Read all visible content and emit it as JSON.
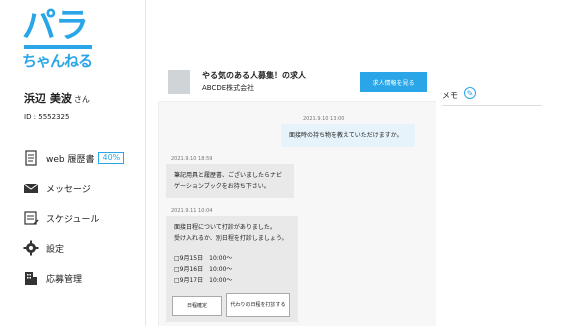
{
  "logo": {
    "line1": "パラ",
    "line2": "ちゃんねる"
  },
  "user": {
    "name": "浜辺 美波",
    "honorific": "さん",
    "id": "ID : 5552325"
  },
  "nav": [
    {
      "label": "web 履歴書",
      "badge": "40%"
    },
    {
      "label": "メッセージ"
    },
    {
      "label": "スケジュール"
    },
    {
      "label": "設定"
    },
    {
      "label": "応募管理"
    }
  ],
  "job": {
    "title": "やる気のある人募集！の求人",
    "company": "ABCDE株式会社",
    "button": "求人情報を見る"
  },
  "memo": {
    "label": "メモ"
  },
  "messages": [
    {
      "time": "2021.9.10 13:00",
      "text": "面接時の持ち物を教えていただけますか。"
    },
    {
      "time": "2021.9.10 18:59",
      "text": "筆記用具と履歴書、ございましたらナビゲーションブックをお持ち下さい。"
    },
    {
      "time": "2021.9.11 10:04",
      "lines": [
        "面接日程について打診がありました。",
        "受け入れるか、別日程を打診しましょう。",
        "",
        "□9月15日　10:00～",
        "□9月16日　10:00～",
        "□9月17日　10:00～"
      ],
      "buttons": [
        "日程確定",
        "代わりの日程を打診する"
      ]
    }
  ]
}
